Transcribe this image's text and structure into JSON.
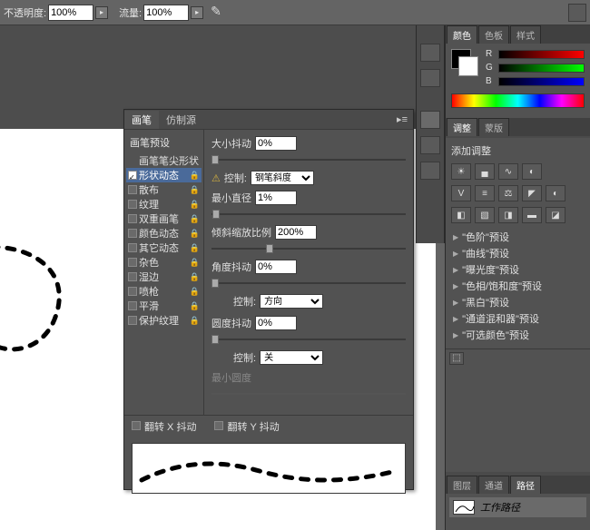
{
  "toolbar": {
    "opacity_label": "不透明度:",
    "opacity_value": "100%",
    "flow_label": "流量:",
    "flow_value": "100%"
  },
  "brush_panel": {
    "tabs": [
      "画笔",
      "仿制源"
    ],
    "list_title": "画笔预设",
    "items": [
      {
        "label": "画笔笔尖形状",
        "no_cb": true
      },
      {
        "label": "形状动态",
        "checked": true,
        "selected": true,
        "lock": true
      },
      {
        "label": "散布",
        "lock": true
      },
      {
        "label": "纹理",
        "lock": true
      },
      {
        "label": "双重画笔",
        "lock": true
      },
      {
        "label": "颜色动态",
        "lock": true
      },
      {
        "label": "其它动态",
        "lock": true
      },
      {
        "label": "杂色",
        "lock": true,
        "muted": false
      },
      {
        "label": "湿边",
        "lock": true
      },
      {
        "label": "喷枪",
        "lock": true
      },
      {
        "label": "平滑",
        "lock": true
      },
      {
        "label": "保护纹理",
        "lock": true
      }
    ],
    "settings": {
      "size_jitter_label": "大小抖动",
      "size_jitter_value": "0%",
      "control1_label": "控制:",
      "control1_value": "钢笔斜度",
      "min_diameter_label": "最小直径",
      "min_diameter_value": "1%",
      "tilt_scale_label": "倾斜缩放比例",
      "tilt_scale_value": "200%",
      "angle_jitter_label": "角度抖动",
      "angle_jitter_value": "0%",
      "control2_label": "控制:",
      "control2_value": "方向",
      "round_jitter_label": "圆度抖动",
      "round_jitter_value": "0%",
      "control3_label": "控制:",
      "control3_value": "关",
      "min_round_label": "最小圆度",
      "flip_x_label": "翻转 X 抖动",
      "flip_y_label": "翻转 Y 抖动"
    }
  },
  "right": {
    "color_tabs": [
      "颜色",
      "色板",
      "样式"
    ],
    "rgb": {
      "r": "R",
      "g": "G",
      "b": "B"
    },
    "adjust_tabs": [
      "调整",
      "蒙版"
    ],
    "adjust_title": "添加调整",
    "presets": [
      "\"色阶\"预设",
      "\"曲线\"预设",
      "\"曝光度\"预设",
      "\"色相/饱和度\"预设",
      "\"黑白\"预设",
      "\"通道混和器\"预设",
      "\"可选颜色\"预设"
    ],
    "layer_tabs": [
      "图层",
      "通道",
      "路径"
    ],
    "work_path": "工作路径"
  }
}
